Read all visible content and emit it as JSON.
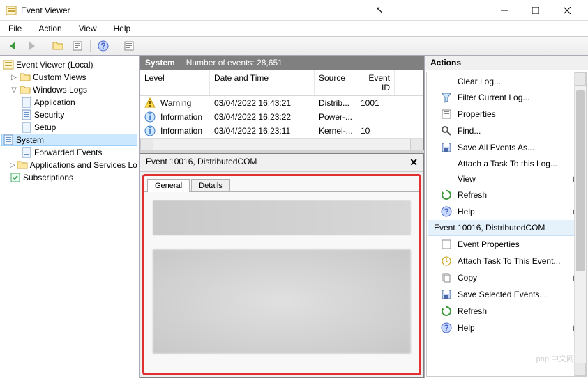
{
  "window": {
    "title": "Event Viewer"
  },
  "menubar": [
    "File",
    "Action",
    "View",
    "Help"
  ],
  "tree": {
    "root": "Event Viewer (Local)",
    "custom": "Custom Views",
    "winlogs": "Windows Logs",
    "app": "Application",
    "sec": "Security",
    "setup": "Setup",
    "system": "System",
    "fwd": "Forwarded Events",
    "appsvc": "Applications and Services Lo",
    "subs": "Subscriptions"
  },
  "center": {
    "title": "System",
    "countLabel": "Number of events: 28,651",
    "cols": {
      "level": "Level",
      "date": "Date and Time",
      "source": "Source",
      "id": "Event ID"
    },
    "rows": [
      {
        "level": "Warning",
        "icon": "warn",
        "date": "03/04/2022 16:43:21",
        "source": "Distrib...",
        "id": "1001"
      },
      {
        "level": "Information",
        "icon": "info",
        "date": "03/04/2022 16:23:22",
        "source": "Power-...",
        "id": ""
      },
      {
        "level": "Information",
        "icon": "info",
        "date": "03/04/2022 16:23:11",
        "source": "Kernel-...",
        "id": "10"
      }
    ],
    "detailTitle": "Event 10016, DistributedCOM",
    "tabs": {
      "general": "General",
      "details": "Details"
    }
  },
  "actions": {
    "title": "Actions",
    "group1": [
      {
        "icon": null,
        "label": "Clear Log..."
      },
      {
        "icon": "filter",
        "label": "Filter Current Log..."
      },
      {
        "icon": "props",
        "label": "Properties"
      },
      {
        "icon": "find",
        "label": "Find..."
      },
      {
        "icon": "save",
        "label": "Save All Events As..."
      },
      {
        "icon": null,
        "label": "Attach a Task To this Log..."
      },
      {
        "icon": null,
        "label": "View",
        "arrow": true
      },
      {
        "icon": "refresh",
        "label": "Refresh"
      },
      {
        "icon": "help",
        "label": "Help",
        "arrow": true
      }
    ],
    "group2title": "Event 10016, DistributedCOM",
    "group2": [
      {
        "icon": "props",
        "label": "Event Properties"
      },
      {
        "icon": "task",
        "label": "Attach Task To This Event..."
      },
      {
        "icon": "copy",
        "label": "Copy",
        "arrow": true
      },
      {
        "icon": "save",
        "label": "Save Selected Events..."
      },
      {
        "icon": "refresh",
        "label": "Refresh"
      },
      {
        "icon": "help",
        "label": "Help",
        "arrow": true
      }
    ]
  },
  "watermark": "php 中文网"
}
